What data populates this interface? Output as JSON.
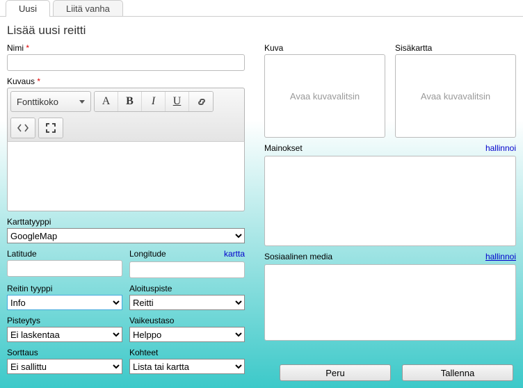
{
  "tabs": {
    "new": "Uusi",
    "attach": "Liitä vanha"
  },
  "heading": "Lisää uusi reitti",
  "left": {
    "name_label": "Nimi",
    "name_value": "",
    "desc_label": "Kuvaus",
    "fontsize_label": "Fonttikoko",
    "maptype_label": "Karttatyyppi",
    "maptype_value": "GoogleMap",
    "lat_label": "Latitude",
    "lat_value": "",
    "lon_label": "Longitude",
    "lon_value": "",
    "map_link": "kartta",
    "routetype_label": "Reitin tyyppi",
    "routetype_value": "Info",
    "startpoint_label": "Aloituspiste",
    "startpoint_value": "Reitti",
    "scoring_label": "Pisteytys",
    "scoring_value": "Ei laskentaa",
    "difficulty_label": "Vaikeustaso",
    "difficulty_value": "Helppo",
    "sorting_label": "Sorttaus",
    "sorting_value": "Ei sallittu",
    "targets_label": "Kohteet",
    "targets_value": "Lista tai kartta"
  },
  "right": {
    "image_label": "Kuva",
    "innermap_label": "Sisäkartta",
    "open_picker": "Avaa kuvavalitsin",
    "ads_label": "Mainokset",
    "manage_link": "hallinnoi",
    "social_label": "Sosiaalinen media"
  },
  "buttons": {
    "cancel": "Peru",
    "save": "Tallenna"
  }
}
